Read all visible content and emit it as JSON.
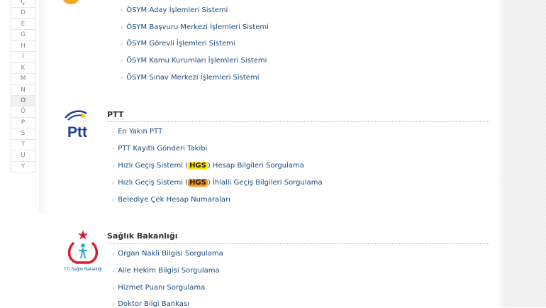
{
  "alphabet": [
    "Ç",
    "D",
    "E",
    "G",
    "H",
    "İ",
    "K",
    "M",
    "N",
    "O",
    "Ö",
    "P",
    "S",
    "T",
    "U",
    "Y"
  ],
  "alphabet_active": "O",
  "osym": {
    "items": [
      {
        "label": "ÖSYM Aday İşlemleri Sistemi"
      },
      {
        "label": "ÖSYM Başvuru Merkezi İşlemleri Sistemi"
      },
      {
        "label": "ÖSYM Görevli İşlemleri Sistemi"
      },
      {
        "label": "ÖSYM Kamu Kurumları İşlemleri Sistemi"
      },
      {
        "label": "ÖSYM Sınav Merkezi İşlemleri Sistemi"
      }
    ]
  },
  "ptt": {
    "title": "PTT",
    "logo_text": "Ptt",
    "items": [
      {
        "label": "En Yakın PTT"
      },
      {
        "label": "PTT Kayıtlı Gönderi Takibi"
      },
      {
        "pre": "Hızlı Geçiş Sistemi (",
        "badge": "HGS",
        "post": ") Hesap Bilgileri Sorgulama"
      },
      {
        "pre": "Hızlı Geçiş Sistemi (",
        "badge": "HGS",
        "post": ") İhlalli Geçiş Bilgileri Sorgulama"
      },
      {
        "label": "Belediye Çek Hesap Numaraları"
      }
    ]
  },
  "saglik": {
    "title": "Sağlık Bakanlığı",
    "logo_caption": "T.C.Sağlık Bakanlığı",
    "items": [
      {
        "label": "Organ Nakli Bilgisi Sorgulama"
      },
      {
        "label": "Aile Hekim Bilgisi Sorgulama"
      },
      {
        "label": "Hizmet Puanı Sorgulama"
      },
      {
        "label": "Doktor Bilgi Bankası"
      }
    ]
  },
  "colors": {
    "link": "#1a4a7a",
    "ptt_blue": "#1c3f94",
    "ptt_yellow": "#ffcc00",
    "saglik_red": "#d7202f",
    "hgs_yellow": "#ffe600",
    "hgs_orange": "#f7931e"
  }
}
